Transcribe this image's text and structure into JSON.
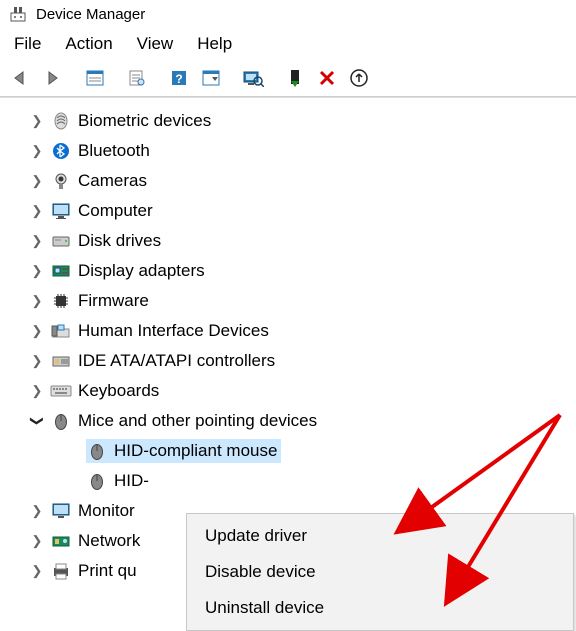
{
  "window": {
    "title": "Device Manager"
  },
  "menu": {
    "file": "File",
    "action": "Action",
    "view": "View",
    "help": "Help"
  },
  "tree": {
    "items": [
      {
        "label": "Biometric devices",
        "icon": "biometric",
        "expanded": false
      },
      {
        "label": "Bluetooth",
        "icon": "bluetooth",
        "expanded": false
      },
      {
        "label": "Cameras",
        "icon": "camera",
        "expanded": false
      },
      {
        "label": "Computer",
        "icon": "computer",
        "expanded": false
      },
      {
        "label": "Disk drives",
        "icon": "disk",
        "expanded": false
      },
      {
        "label": "Display adapters",
        "icon": "display",
        "expanded": false
      },
      {
        "label": "Firmware",
        "icon": "firmware",
        "expanded": false
      },
      {
        "label": "Human Interface Devices",
        "icon": "hid",
        "expanded": false
      },
      {
        "label": "IDE ATA/ATAPI controllers",
        "icon": "ide",
        "expanded": false
      },
      {
        "label": "Keyboards",
        "icon": "keyboard",
        "expanded": false
      },
      {
        "label": "Mice and other pointing devices",
        "icon": "mouse",
        "expanded": true
      },
      {
        "label": "Monitor",
        "icon": "monitor",
        "expanded": false,
        "cut": true
      },
      {
        "label": "Network",
        "icon": "network",
        "expanded": false,
        "cut": true
      },
      {
        "label": "Print qu",
        "icon": "printer",
        "expanded": false,
        "cut": true
      }
    ],
    "mice_children": [
      {
        "label": "HID-compliant mouse",
        "selected": true
      },
      {
        "label": "HID-"
      }
    ]
  },
  "context_menu": {
    "items": [
      "Update driver",
      "Disable device",
      "Uninstall device"
    ]
  }
}
